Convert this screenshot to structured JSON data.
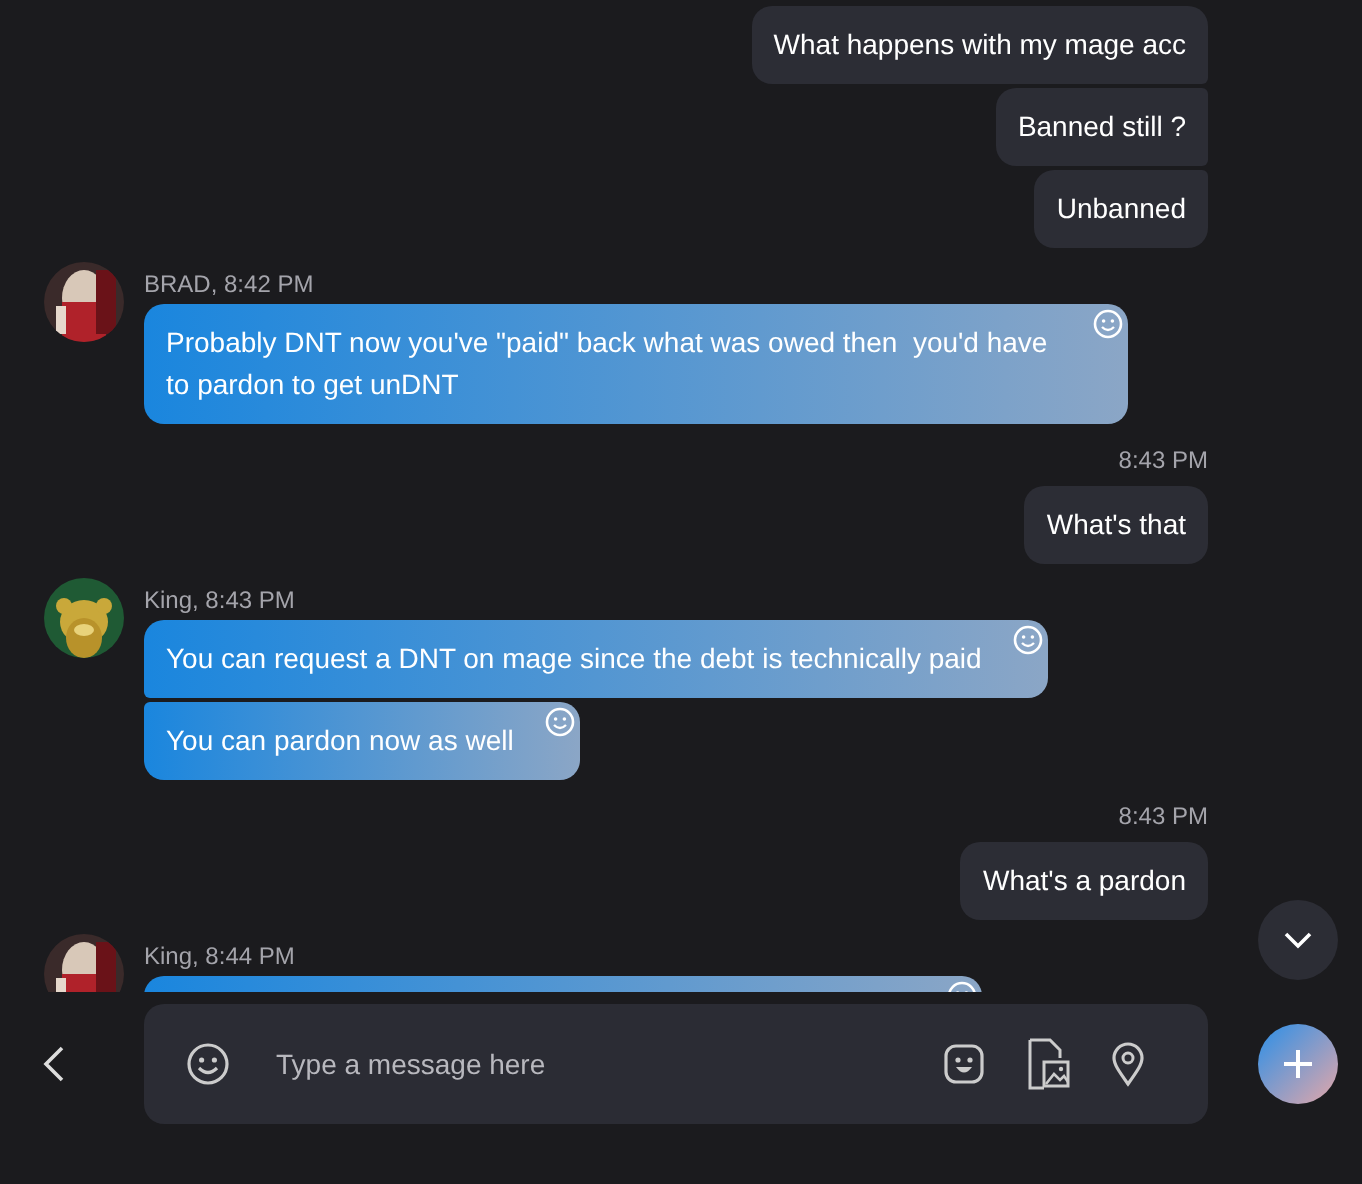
{
  "messages": [
    {
      "kind": "outgoing",
      "bubbles": [
        {
          "text": "What happens with my mage acc"
        },
        {
          "text": "Banned still ?"
        },
        {
          "text": "Unbanned"
        }
      ]
    },
    {
      "kind": "incoming",
      "sender": "BRAD, 8:42 PM",
      "bubbles": [
        {
          "text": "Probably DNT now you've \"paid\" back what was owed then  you'd have to pardon to get unDNT"
        }
      ]
    },
    {
      "kind": "outgoing",
      "time": "8:43 PM",
      "bubbles": [
        {
          "text": "What's that"
        }
      ]
    },
    {
      "kind": "incoming",
      "sender": "King, 8:43 PM",
      "bubbles": [
        {
          "text": "You can request a DNT on mage since the debt is technically paid"
        },
        {
          "text": "You can pardon now as well"
        }
      ]
    },
    {
      "kind": "outgoing",
      "time": "8:43 PM",
      "bubbles": [
        {
          "text": "What's a pardon"
        }
      ]
    },
    {
      "kind": "incoming_cut",
      "sender": "King, 8:44 PM"
    }
  ],
  "composer": {
    "placeholder": "Type a message here"
  }
}
